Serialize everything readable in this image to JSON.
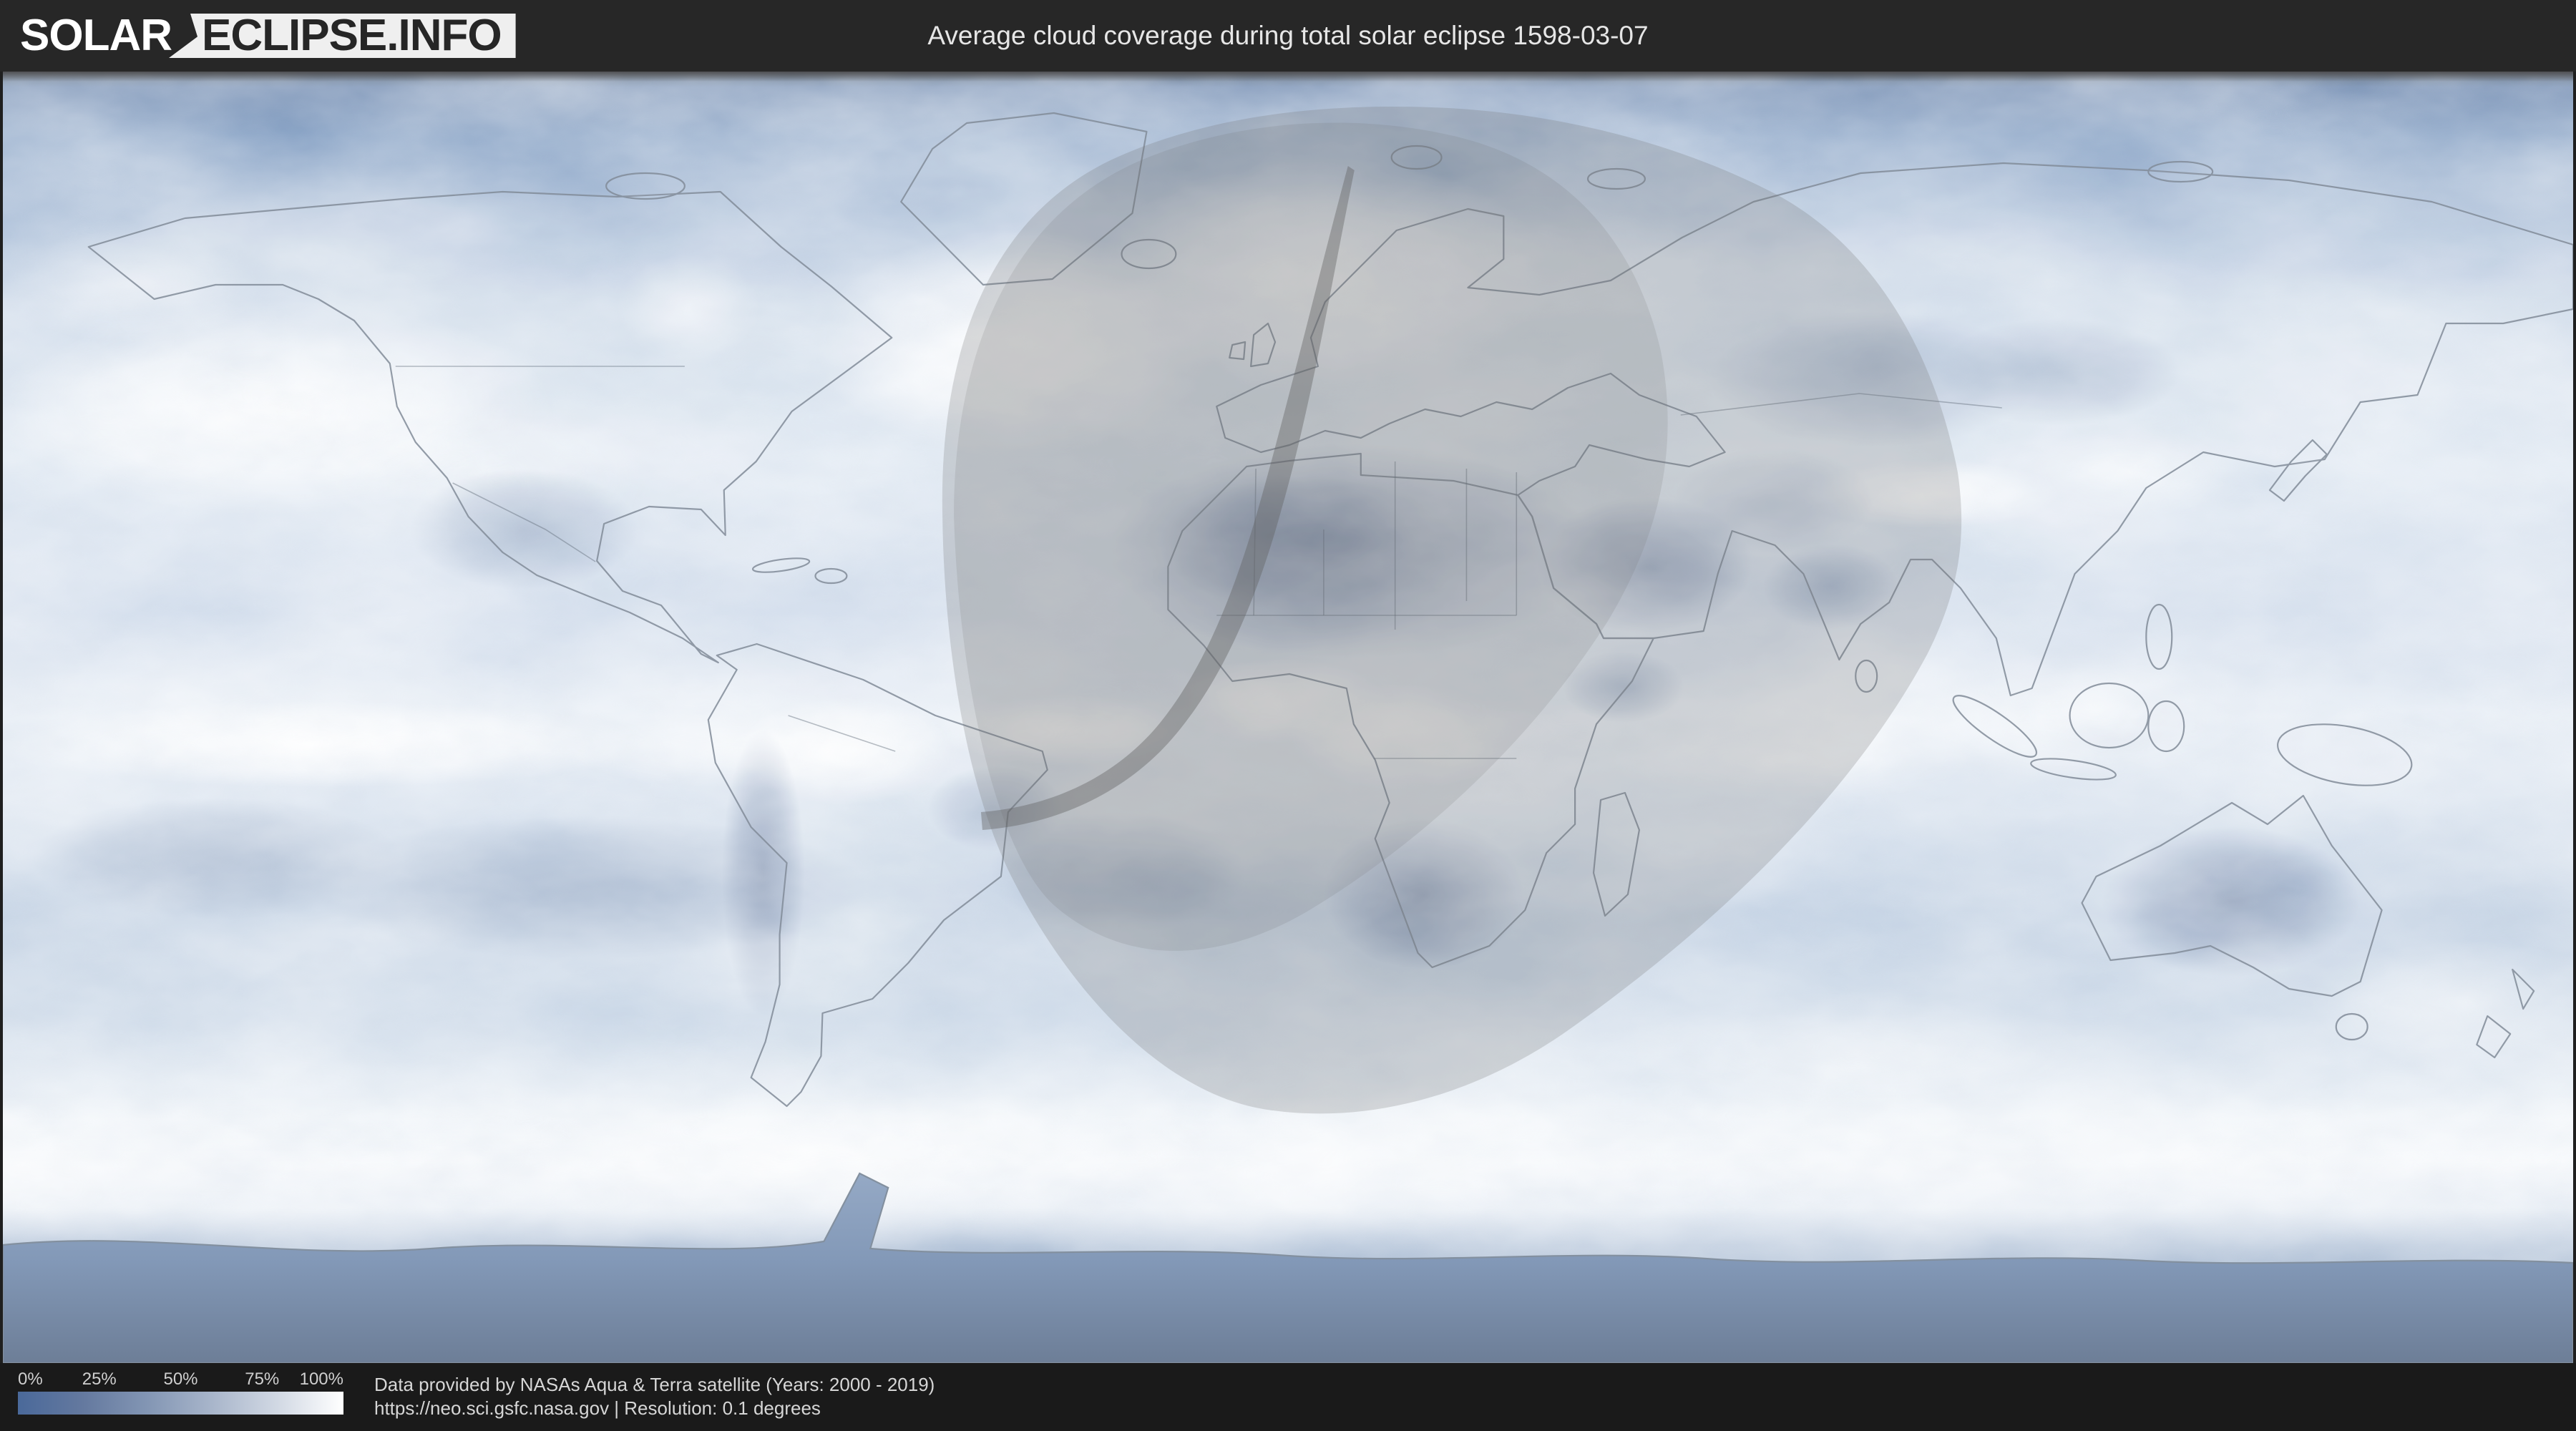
{
  "header": {
    "logo_primary": "SOLAR",
    "logo_secondary": "ECLIPSE.INFO",
    "title": "Average cloud coverage during total solar eclipse 1598-03-07"
  },
  "map": {
    "description": "World map of average cloud coverage with eclipse shadow overlay and path of totality",
    "shadow_color": "#707070",
    "low_coverage_color": "#4a699a",
    "high_coverage_color": "#ffffff"
  },
  "legend": {
    "ticks": [
      "0%",
      "25%",
      "50%",
      "75%",
      "100%"
    ],
    "gradient_start": "#4a699a",
    "gradient_end": "#ffffff"
  },
  "footer": {
    "line1": "Data provided by NASAs Aqua & Terra satellite (Years: 2000 - 2019)",
    "line2": "https://neo.sci.gsfc.nasa.gov | Resolution: 0.1 degrees"
  }
}
